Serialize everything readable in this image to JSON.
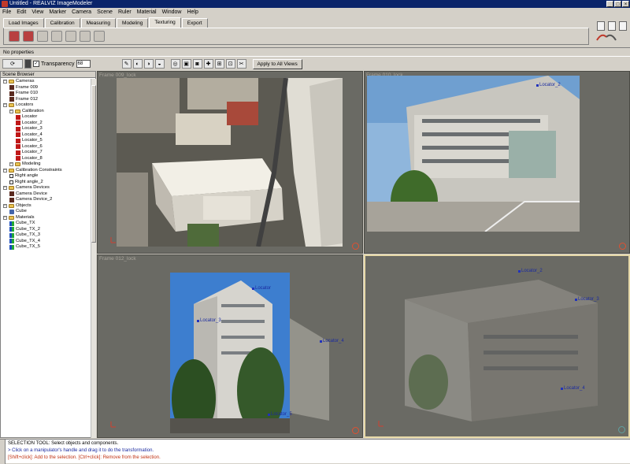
{
  "window": {
    "title": "Untitled - REALVIZ ImageModeler"
  },
  "menu": [
    "File",
    "Edit",
    "View",
    "Marker",
    "Camera",
    "Scene",
    "Ruler",
    "Material",
    "Window",
    "Help"
  ],
  "tabs": [
    "Load Images",
    "Calibration",
    "Measuring",
    "Modeling",
    "Texturing",
    "Export"
  ],
  "active_tab": "Texturing",
  "properties": {
    "label": "No properties"
  },
  "viewbar": {
    "transparency_label": "Transparency",
    "transparency_value": "68",
    "apply_label": "Apply to All Views"
  },
  "browser": {
    "title": "Scene Browser",
    "nodes": [
      {
        "t": "Cameras",
        "lvl": 0,
        "icon": "folder"
      },
      {
        "t": "Frame 009",
        "lvl": 1,
        "icon": "camera"
      },
      {
        "t": "Frame 010",
        "lvl": 1,
        "icon": "camera"
      },
      {
        "t": "Frame 012",
        "lvl": 1,
        "icon": "camera"
      },
      {
        "t": "Locators",
        "lvl": 0,
        "icon": "folder"
      },
      {
        "t": "Calibration",
        "lvl": 1,
        "icon": "folder"
      },
      {
        "t": "Locator",
        "lvl": 2,
        "icon": "locator"
      },
      {
        "t": "Locator_2",
        "lvl": 2,
        "icon": "locator"
      },
      {
        "t": "Locator_3",
        "lvl": 2,
        "icon": "locator"
      },
      {
        "t": "Locator_4",
        "lvl": 2,
        "icon": "locator"
      },
      {
        "t": "Locator_5",
        "lvl": 2,
        "icon": "locator"
      },
      {
        "t": "Locator_6",
        "lvl": 2,
        "icon": "locator"
      },
      {
        "t": "Locator_7",
        "lvl": 2,
        "icon": "locator"
      },
      {
        "t": "Locator_8",
        "lvl": 2,
        "icon": "locator"
      },
      {
        "t": "Modeling",
        "lvl": 1,
        "icon": "folder"
      },
      {
        "t": "Calibration Constraints",
        "lvl": 0,
        "icon": "folder"
      },
      {
        "t": "Right angle",
        "lvl": 1,
        "icon": "constraint"
      },
      {
        "t": "Right angle_2",
        "lvl": 1,
        "icon": "constraint"
      },
      {
        "t": "Camera Devices",
        "lvl": 0,
        "icon": "folder"
      },
      {
        "t": "Camera Device",
        "lvl": 1,
        "icon": "device"
      },
      {
        "t": "Camera Device_2",
        "lvl": 1,
        "icon": "device"
      },
      {
        "t": "Objects",
        "lvl": 0,
        "icon": "folder"
      },
      {
        "t": "Cube",
        "lvl": 1,
        "icon": "cube"
      },
      {
        "t": "Materials",
        "lvl": 0,
        "icon": "folder"
      },
      {
        "t": "Cube_TX",
        "lvl": 1,
        "icon": "material"
      },
      {
        "t": "Cube_TX_2",
        "lvl": 1,
        "icon": "material"
      },
      {
        "t": "Cube_TX_3",
        "lvl": 1,
        "icon": "material"
      },
      {
        "t": "Cube_TX_4",
        "lvl": 1,
        "icon": "material"
      },
      {
        "t": "Cube_TX_5",
        "lvl": 1,
        "icon": "material"
      }
    ]
  },
  "viewports": [
    {
      "label": "Frame 009_lock"
    },
    {
      "label": "Frame 010_lock",
      "locators": [
        "Locator_2"
      ]
    },
    {
      "label": "Frame 012_lock",
      "locators": [
        "Locator",
        "Locator_3",
        "Locator_4",
        "Locator_5"
      ]
    },
    {
      "label": "",
      "locators": [
        "Locator_2",
        "Locator_3",
        "Locator_4"
      ]
    }
  ],
  "console": {
    "side_label": "Console",
    "lines": [
      {
        "text": "SELECTION TOOL: Select objects and components.",
        "color": "#000000"
      },
      {
        "text": "> Click on a manipulator's handle and drag it to do the transformation.",
        "color": "#1a2aa0"
      },
      {
        "text": "[Shift+click]: Add to the selection. [Ctrl+click]: Remove from the selection.",
        "color": "#c03010"
      }
    ]
  },
  "colors": {
    "title_bar": "#0a246a",
    "viewport_bg": "#6a6a64",
    "selection_border": "#e7d9a8",
    "locator": "#2233bb"
  }
}
